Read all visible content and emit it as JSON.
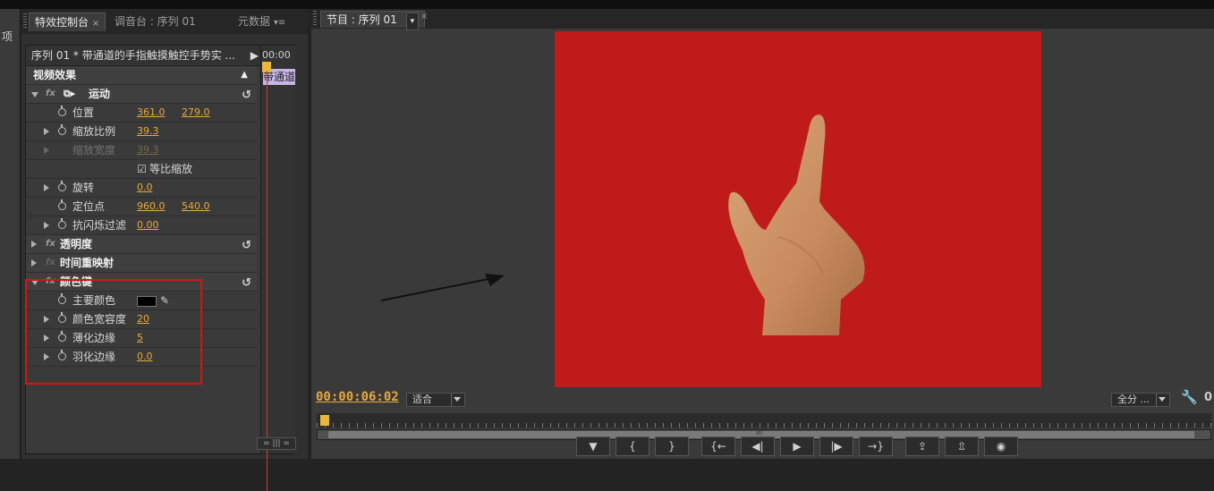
{
  "left_panel": {
    "label": "项"
  },
  "effect_controls": {
    "tabs": [
      {
        "label": "特效控制台",
        "active": true,
        "close": "×"
      },
      {
        "label": "调音台 : 序列 01",
        "active": false
      },
      {
        "label": "元数据",
        "active": false,
        "menu": "▾≡"
      }
    ],
    "sequence_label": "序列 01 * 带通道的手指触摸触控手势实 ...",
    "timecode": "00:00",
    "clip_label": "带通道",
    "section_title": "视频效果",
    "motion": {
      "name": "运动",
      "position_label": "位置",
      "position_x": "361.0",
      "position_y": "279.0",
      "scale_label": "缩放比例",
      "scale": "39.3",
      "scale_width_label": "缩放宽度",
      "scale_width": "39.3",
      "uniform_label": "等比缩放",
      "rotation_label": "旋转",
      "rotation": "0.0",
      "anchor_label": "定位点",
      "anchor_x": "960.0",
      "anchor_y": "540.0",
      "flicker_label": "抗闪烁过滤",
      "flicker": "0.00"
    },
    "opacity_label": "透明度",
    "time_remap_label": "时间重映射",
    "color_key": {
      "name": "颜色键",
      "key_color_label": "主要颜色",
      "key_color": "#000000",
      "tolerance_label": "颜色宽容度",
      "tolerance": "20",
      "thin_label": "薄化边缘",
      "thin": "5",
      "feather_label": "羽化边缘",
      "feather": "0.0"
    }
  },
  "program": {
    "tab_label": "节目 : 序列 01",
    "tab_close": "×",
    "timecode": "00:00:06:02",
    "fit_label": "适合",
    "quality_label": "全分 ...",
    "right_edge_label": "0",
    "scroll_label": "III",
    "video_bg": "#bf1b1b"
  },
  "transport": {
    "buttons": [
      "▼",
      "{",
      "}",
      "{←",
      "◀|",
      "▶",
      "|▶",
      "→}",
      "⇪",
      "⇫",
      "◉"
    ]
  }
}
